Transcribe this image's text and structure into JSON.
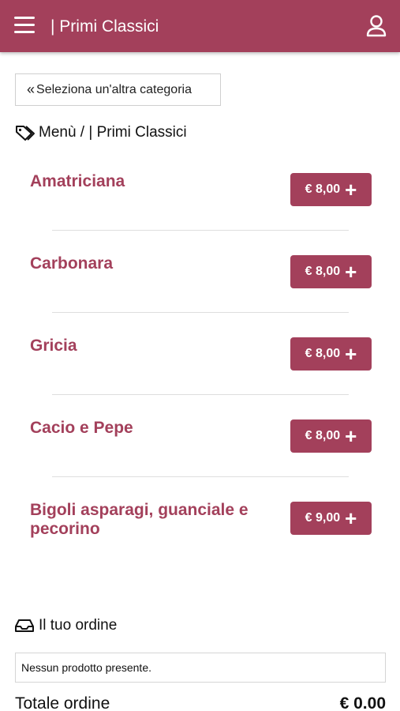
{
  "header": {
    "title": "| Primi Classici",
    "menu_icon": "hamburger-icon",
    "user_icon": "user-icon",
    "color": "#a3405b"
  },
  "back_button": {
    "chevrons": "«",
    "label": "Seleziona un'altra categoria"
  },
  "breadcrumb": {
    "icon": "tag-icon",
    "text": "Menù / | Primi Classici"
  },
  "items": [
    {
      "name": "Amatriciana",
      "price": "€ 8,00"
    },
    {
      "name": "Carbonara",
      "price": "€ 8,00"
    },
    {
      "name": "Gricia",
      "price": "€ 8,00"
    },
    {
      "name": "Cacio e Pepe",
      "price": "€ 8,00"
    },
    {
      "name": "Bigoli asparagi, guanciale e pecorino",
      "price": "€ 9,00"
    }
  ],
  "order": {
    "icon": "inbox-icon",
    "title": "Il tuo ordine",
    "empty_message": "Nessun prodotto presente.",
    "total_label": "Totale ordine",
    "total_value": "€ 0.00"
  }
}
